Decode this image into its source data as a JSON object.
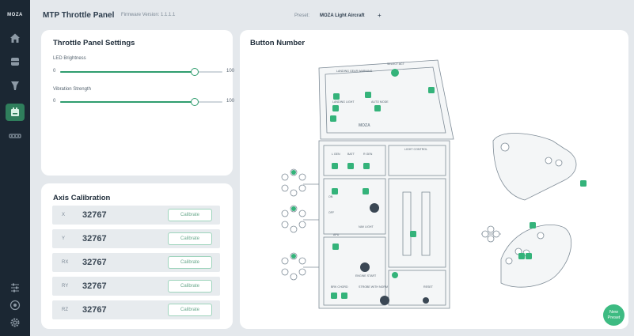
{
  "sidebar": {
    "logo": "MOZA",
    "items": [
      {
        "name": "home-icon"
      },
      {
        "name": "wheelbase-icon"
      },
      {
        "name": "pedals-icon"
      },
      {
        "name": "throttle-panel-icon",
        "active": true
      },
      {
        "name": "switch-panel-icon"
      }
    ],
    "bottom_items": [
      {
        "name": "sliders-icon"
      },
      {
        "name": "help-icon"
      },
      {
        "name": "gear-icon"
      }
    ]
  },
  "header": {
    "title": "MTP Throttle Panel",
    "firmware": "Firmware Version: 1.1.1.1",
    "preset_label": "Preset:",
    "preset_name": "MOZA Light Aircraft",
    "preset_add": "+"
  },
  "settings": {
    "title": "Throttle Panel Settings",
    "led": {
      "label": "LED Brightness",
      "min": "0",
      "max": "100",
      "value": 83,
      "value_text": "83",
      "unit": "%"
    },
    "vibration": {
      "label": "Vibration Strength",
      "min": "0",
      "max": "100",
      "value": 83,
      "value_text": "83",
      "unit": "%"
    }
  },
  "axis": {
    "title": "Axis Calibration",
    "calibrate_label": "Calibrate",
    "rows": [
      {
        "name": "X",
        "value": "32767"
      },
      {
        "name": "Y",
        "value": "32767"
      },
      {
        "name": "RX",
        "value": "32767"
      },
      {
        "name": "RY",
        "value": "32767"
      },
      {
        "name": "RZ",
        "value": "32767"
      }
    ]
  },
  "button_panel": {
    "title": "Button Number",
    "panel_labels": {
      "landing_gear": "LANDING GEAR WARNING",
      "select_act": "SELECT ACT",
      "landing_light": "LANDING LIGHT",
      "auto_mode": "AUTO MODE",
      "l_gen": "L GEN",
      "batt": "BATT",
      "r_gen": "R GEN",
      "light_control": "LIGHT CONTROL",
      "on": "ON",
      "off": "OFF",
      "apu": "APU",
      "engine_start": "ENGINE START",
      "nav_light": "NAV LIGHT",
      "brk_chord": "BRK CHORD",
      "strobe": "STROBE WITH NORM",
      "reset": "RESET",
      "brand": "MOZA"
    },
    "accent": "#34b37a"
  },
  "new_preset": {
    "line1": "New",
    "line2": "Preset"
  },
  "colors": {
    "sidebar": "#1b2733",
    "accent": "#34b37a",
    "background": "#e4e8ec"
  }
}
